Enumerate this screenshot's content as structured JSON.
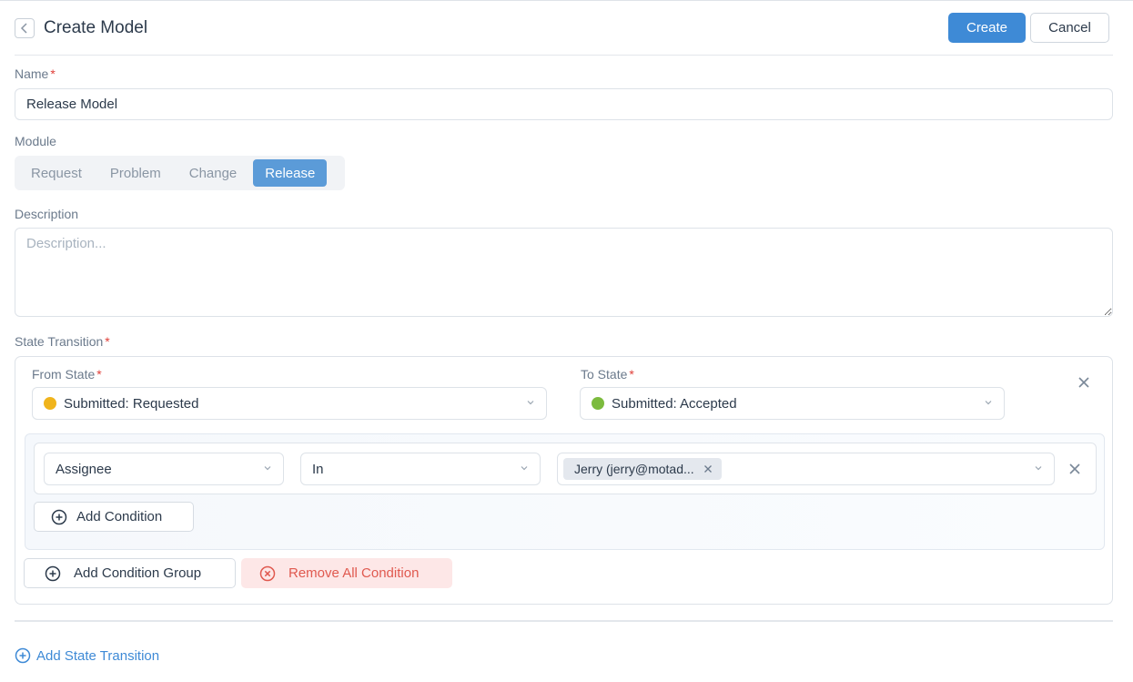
{
  "header": {
    "title": "Create Model",
    "create_label": "Create",
    "cancel_label": "Cancel"
  },
  "form": {
    "name": {
      "label": "Name",
      "value": "Release Model"
    },
    "module": {
      "label": "Module",
      "options": [
        "Request",
        "Problem",
        "Change",
        "Release"
      ],
      "selected": "Release"
    },
    "description": {
      "label": "Description",
      "placeholder": "Description...",
      "value": ""
    }
  },
  "state_transition": {
    "label": "State Transition",
    "from_state": {
      "label": "From State",
      "value": "Submitted: Requested",
      "dot_color": "#f0b41c"
    },
    "to_state": {
      "label": "To State",
      "value": "Submitted: Accepted",
      "dot_color": "#7cbb3e"
    },
    "condition": {
      "field": "Assignee",
      "operator": "In",
      "chip": "Jerry (jerry@motad..."
    },
    "add_condition_label": "Add Condition",
    "add_condition_group_label": "Add Condition Group",
    "remove_all_label": "Remove All Condition"
  },
  "add_state_transition_label": "Add State Transition",
  "colors": {
    "primary": "#3e8ad6",
    "danger": "#e0594f",
    "danger_bg": "#fde7e7"
  }
}
